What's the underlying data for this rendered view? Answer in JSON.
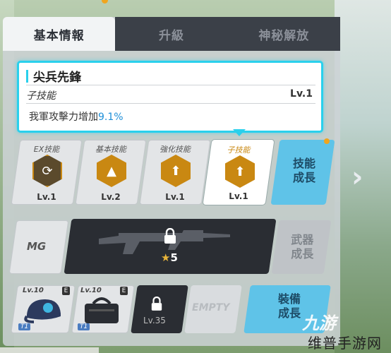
{
  "tabs": [
    {
      "label": "基本情報",
      "active": true
    },
    {
      "label": "升級",
      "active": false
    },
    {
      "label": "神秘解放",
      "active": false
    }
  ],
  "tooltip": {
    "title": "尖兵先鋒",
    "subtitle": "子技能",
    "level": "Lv.1",
    "desc_prefix": "我軍攻擊力增加",
    "desc_value": "9.1%"
  },
  "skills": [
    {
      "name": "EX技能",
      "level": "Lv.1",
      "icon": "ex-skill-icon"
    },
    {
      "name": "基本技能",
      "level": "Lv.2",
      "icon": "flame-icon"
    },
    {
      "name": "強化技能",
      "level": "Lv.1",
      "icon": "gun-up-icon"
    },
    {
      "name": "子技能",
      "level": "Lv.1",
      "icon": "gun-up-icon",
      "selected": true
    }
  ],
  "skill_growth": {
    "label": "技能\n成長"
  },
  "weapon": {
    "type": "MG",
    "star_count": "5",
    "growth_label": "武器\n成長"
  },
  "equipment": [
    {
      "level": "Lv.10",
      "badge": "E",
      "tier": "T1",
      "icon": "cap-icon"
    },
    {
      "level": "Lv.10",
      "badge": "E",
      "tier": "T1",
      "icon": "bag-icon"
    },
    {
      "level": "Lv.35",
      "locked": true
    },
    {
      "label": "EMPTY"
    }
  ],
  "equipment_growth": {
    "label": "裝備\n成長"
  },
  "watermark": {
    "logo": "九游",
    "text": "维普手游网"
  },
  "colors": {
    "accent_cyan": "#2ad0ec",
    "skill_gold": "#c98812",
    "growth_blue": "#5fc3e8",
    "highlight_blue": "#1e8fd8"
  }
}
